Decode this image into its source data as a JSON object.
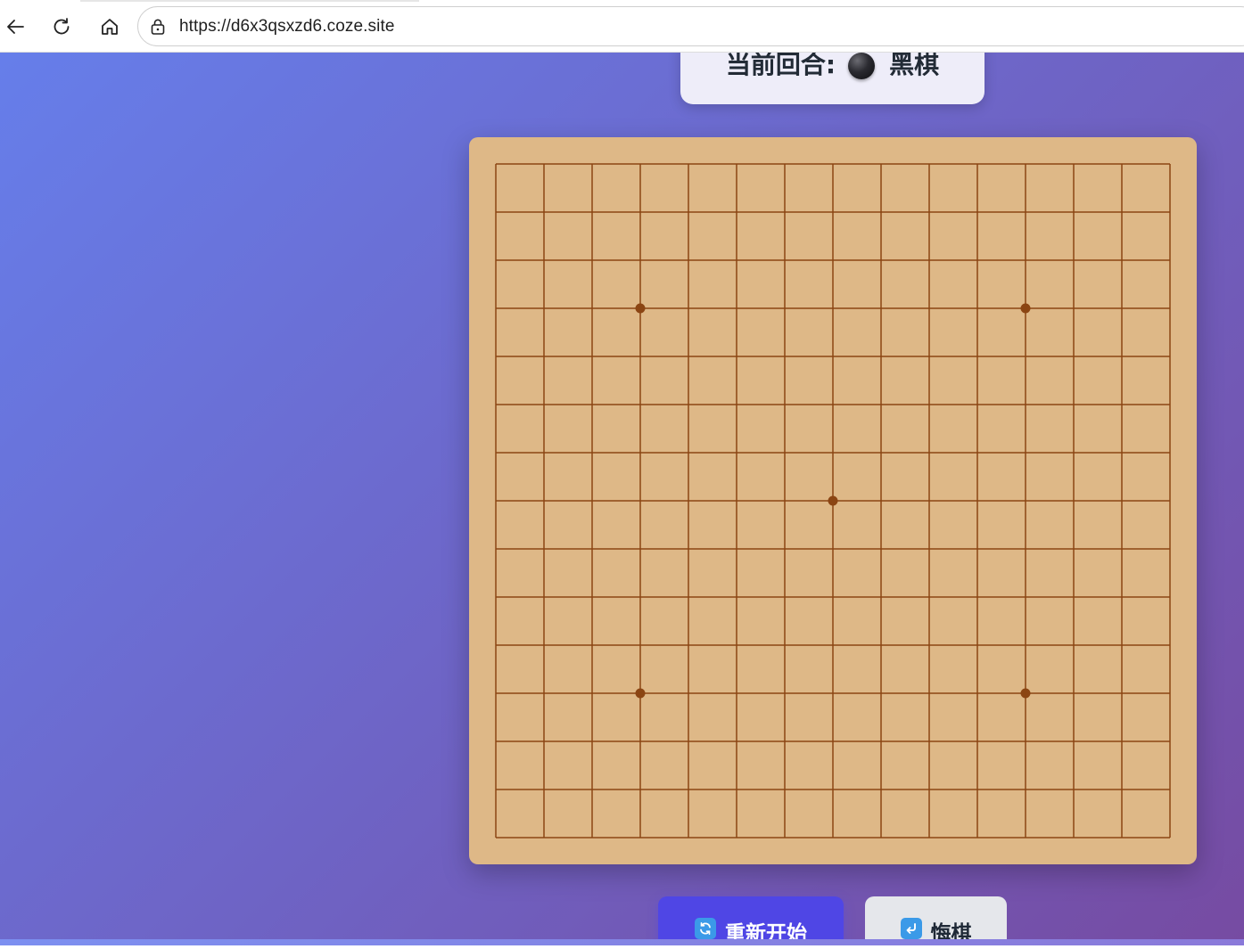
{
  "browser": {
    "url": "https://d6x3qsxzd6.coze.site",
    "back_icon": "back-arrow-icon",
    "reload_icon": "reload-icon",
    "home_icon": "home-icon",
    "lock_icon": "lock-icon"
  },
  "status": {
    "label": "当前回合:",
    "current_player": "黑棋",
    "stone_color": "black"
  },
  "board": {
    "lines": 15,
    "star_points": [
      [
        3,
        3
      ],
      [
        3,
        11
      ],
      [
        7,
        7
      ],
      [
        11,
        3
      ],
      [
        11,
        11
      ]
    ],
    "board_color": "#deb887",
    "line_color": "#8b4513"
  },
  "controls": {
    "restart_label": "重新开始",
    "restart_icon": "refresh-icon",
    "undo_label": "悔棋",
    "undo_icon": "return-arrow-icon"
  },
  "colors": {
    "gradient_start": "#667eea",
    "gradient_end": "#764ba2",
    "primary_button": "#4f46e5",
    "secondary_button": "#e5e7eb"
  }
}
